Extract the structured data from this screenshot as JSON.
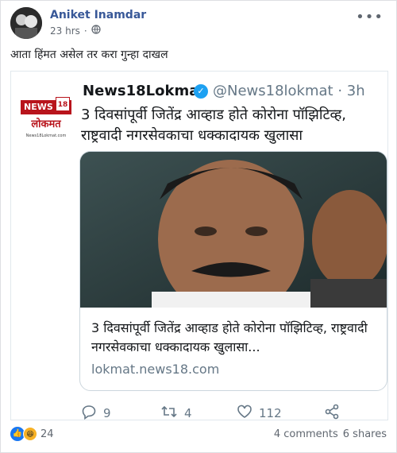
{
  "post": {
    "author": "Aniket Inamdar",
    "time": "23 hrs",
    "separator": "·",
    "privacy_icon": "globe-icon",
    "more_icon": "more-options-icon",
    "caption": "आता हिंमत असेल तर करा गुन्हा दाखल"
  },
  "tweet": {
    "logo": {
      "news": "NEWS",
      "num": "18",
      "lokmat": "लोकमत",
      "url": "News18Lokmat.com"
    },
    "name": "News18Lokmat",
    "verified_icon": "verified-badge-icon",
    "handle": "@News18lokmat · 3h",
    "text": "3 दिवसांपूर्वी जितेंद्र आव्हाड होते कोरोना पॉझिटिव्ह, राष्ट्रवादी नगरसेवकाचा धक्कादायक खुलासा",
    "card": {
      "title": "3 दिवसांपूर्वी जितेंद्र आव्हाड होते कोरोना पॉझिटिव्ह, राष्ट्रवादी नगरसेवकाचा धक्कादायक खुलासा...",
      "domain": "lokmat.news18.com"
    },
    "actions": {
      "replies": "9",
      "retweets": "4",
      "likes": "112"
    }
  },
  "footer": {
    "reaction_count": "24",
    "comments": "4 comments",
    "shares": "6 shares"
  },
  "colors": {
    "facebook_link": "#385898",
    "twitter_blue": "#1da1f2",
    "news18_red": "#b8141c"
  }
}
